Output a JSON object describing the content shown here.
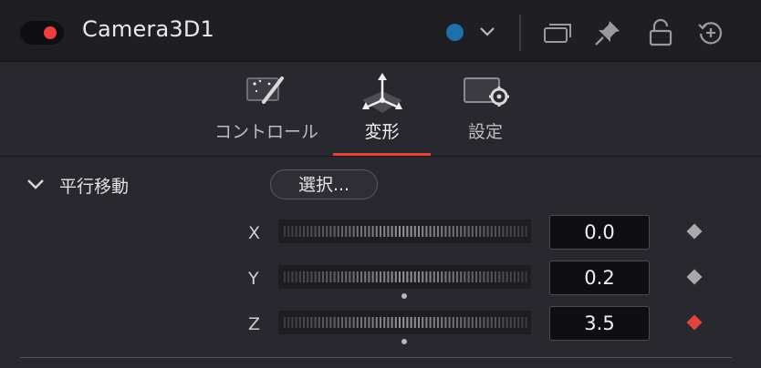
{
  "header": {
    "title": "Camera3D1",
    "colors": {
      "enable_dot": "#ee3f3f",
      "node_color": "#1f6fa8"
    },
    "icons": [
      "enable-toggle",
      "color-dot-icon",
      "chevron-down-icon",
      "versions-icon",
      "pin-icon",
      "lock-icon",
      "reset-icon"
    ]
  },
  "tabs": [
    {
      "label": "コントロール",
      "icon": "controls-wand-icon",
      "active": false
    },
    {
      "label": "変形",
      "icon": "transform-icon",
      "active": true
    },
    {
      "label": "設定",
      "icon": "settings-monitor-icon",
      "active": false
    }
  ],
  "section": {
    "title": "平行移動",
    "expanded": true,
    "select_label": "選択..."
  },
  "params": [
    {
      "label": "X",
      "value": "0.0",
      "keyframe_color": "#a9a9ad",
      "keyed": false,
      "center_marker": false
    },
    {
      "label": "Y",
      "value": "0.2",
      "keyframe_color": "#a9a9ad",
      "keyed": false,
      "center_marker": true
    },
    {
      "label": "Z",
      "value": "3.5",
      "keyframe_color": "#e0443c",
      "keyed": true,
      "center_marker": true
    }
  ]
}
